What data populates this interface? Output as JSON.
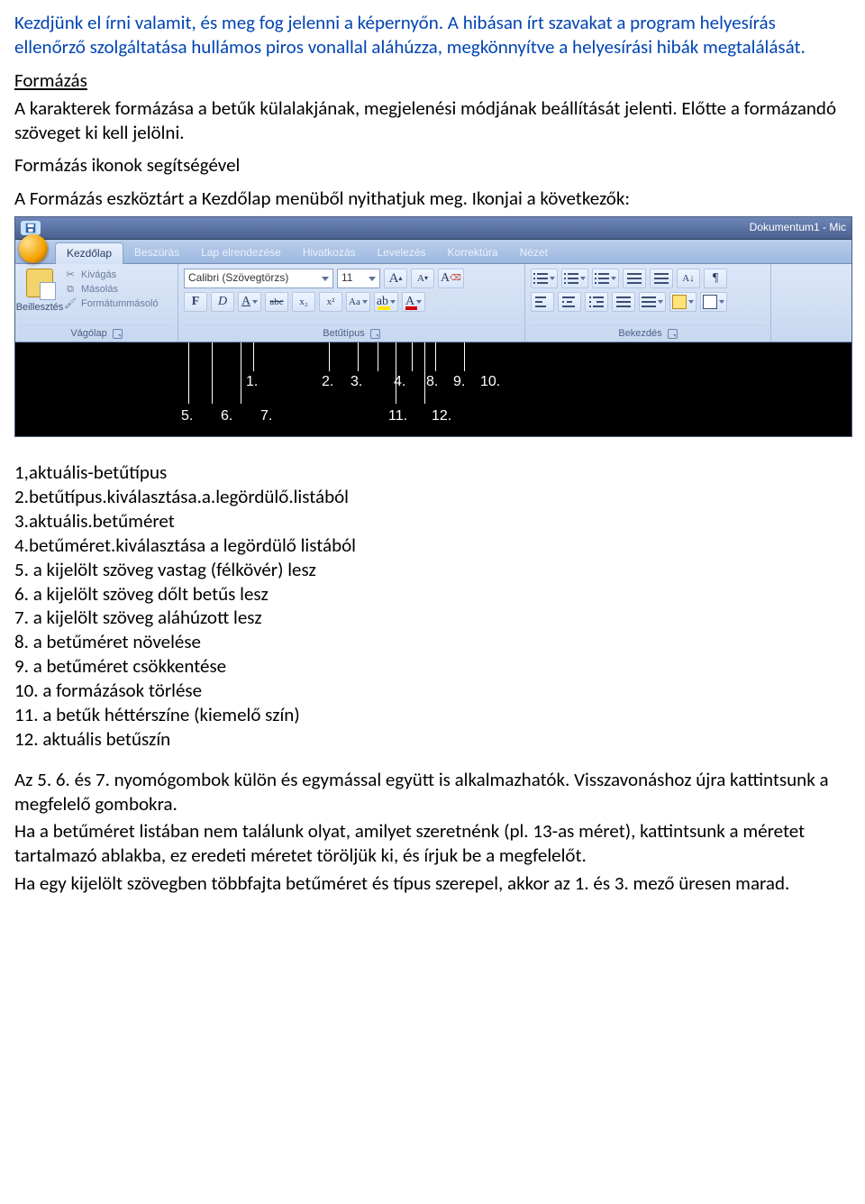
{
  "intro": "Kezdjünk el írni valamit, és meg fog jelenni a képernyőn. A hibásan írt szavakat a program helyesírás ellenőrző szolgáltatása hullámos piros vonallal aláhúzza,  megkönnyítve a helyesírási hibák megtalálását.",
  "heading_formazas": "Formázás",
  "para_formazas": "A karakterek formázása a betűk külalakjának, megjelenési módjának beállítását jelenti. Előtte a formázandó szöveget ki kell jelölni.",
  "para_ikon": "Formázás ikonok segítségével",
  "para_eszkoztar": "A Formázás eszköztárt a Kezdőlap menüből nyithatjuk meg. Ikonjai a következők:",
  "ribbon": {
    "doc_title": "Dokumentum1 - Mic",
    "tabs": {
      "kezdolap": "Kezdőlap",
      "beszuras": "Beszúrás",
      "lap": "Lap elrendezése",
      "hivatkozas": "Hivatkozás",
      "levelezes": "Levelezés",
      "korrektura": "Korrektúra",
      "nezet": "Nézet"
    },
    "clipboard": {
      "paste": "Beillesztés",
      "cut": "Kivágás",
      "copy": "Másolás",
      "painter": "Formátummásoló",
      "label": "Vágólap"
    },
    "font": {
      "name": "Calibri (Szövegtörzs)",
      "size": "11",
      "bold": "F",
      "italic": "D",
      "underline": "A",
      "strike": "abc",
      "sub": "x₂",
      "sup": "x²",
      "case": "Aa",
      "highlight": "ab",
      "color": "A",
      "grow": "A",
      "shrink": "A",
      "clear": "A",
      "label": "Betűtípus"
    },
    "paragraph": {
      "label": "Bekezdés",
      "sort": "A↓",
      "pilcrow": "¶"
    }
  },
  "annot_numbers": {
    "n1": "1.",
    "n2": "2.",
    "n3": "3.",
    "n4": "4.",
    "n5": "5.",
    "n6": "6.",
    "n7": "7.",
    "n8": "8.",
    "n9": "9.",
    "n10": "10.",
    "n11": "11.",
    "n12": "12."
  },
  "list": {
    "i1": "1,aktuális-betűtípus",
    "i2": "2.betűtípus.kiválasztása.a.legördülő.listából",
    "i3": "3.aktuális.betűméret",
    "i4": "4.betűméret.kiválasztása a legördülő listából",
    "i5": "5.   a kijelölt szöveg vastag (félkövér) lesz",
    "i6": "6.   a kijelölt szöveg dőlt betűs lesz",
    "i7": "7.   a kijelölt szöveg aláhúzott lesz",
    "i8": "8.   a betűméret növelése",
    "i9": "9.   a betűméret csökkentése",
    "i10": "10. a formázások törlése",
    "i11": "11. a betűk héttérszíne (kiemelő szín)",
    "i12": "12. aktuális betűszín"
  },
  "closing": {
    "p1": "Az 5. 6. és 7. nyomógombok külön és egymással együtt is alkalmazhatók. Visszavonáshoz újra kattintsunk a megfelelő gombokra.",
    "p2": "Ha a betűméret listában nem találunk olyat, amilyet szeretnénk (pl. 13-as méret), kattintsunk a méretet tartalmazó ablakba, ez eredeti méretet töröljük ki, és írjuk be a megfelelőt.",
    "p3": "Ha egy kijelölt szövegben többfajta betűméret és típus szerepel, akkor az 1. és 3. mező üresen marad."
  }
}
